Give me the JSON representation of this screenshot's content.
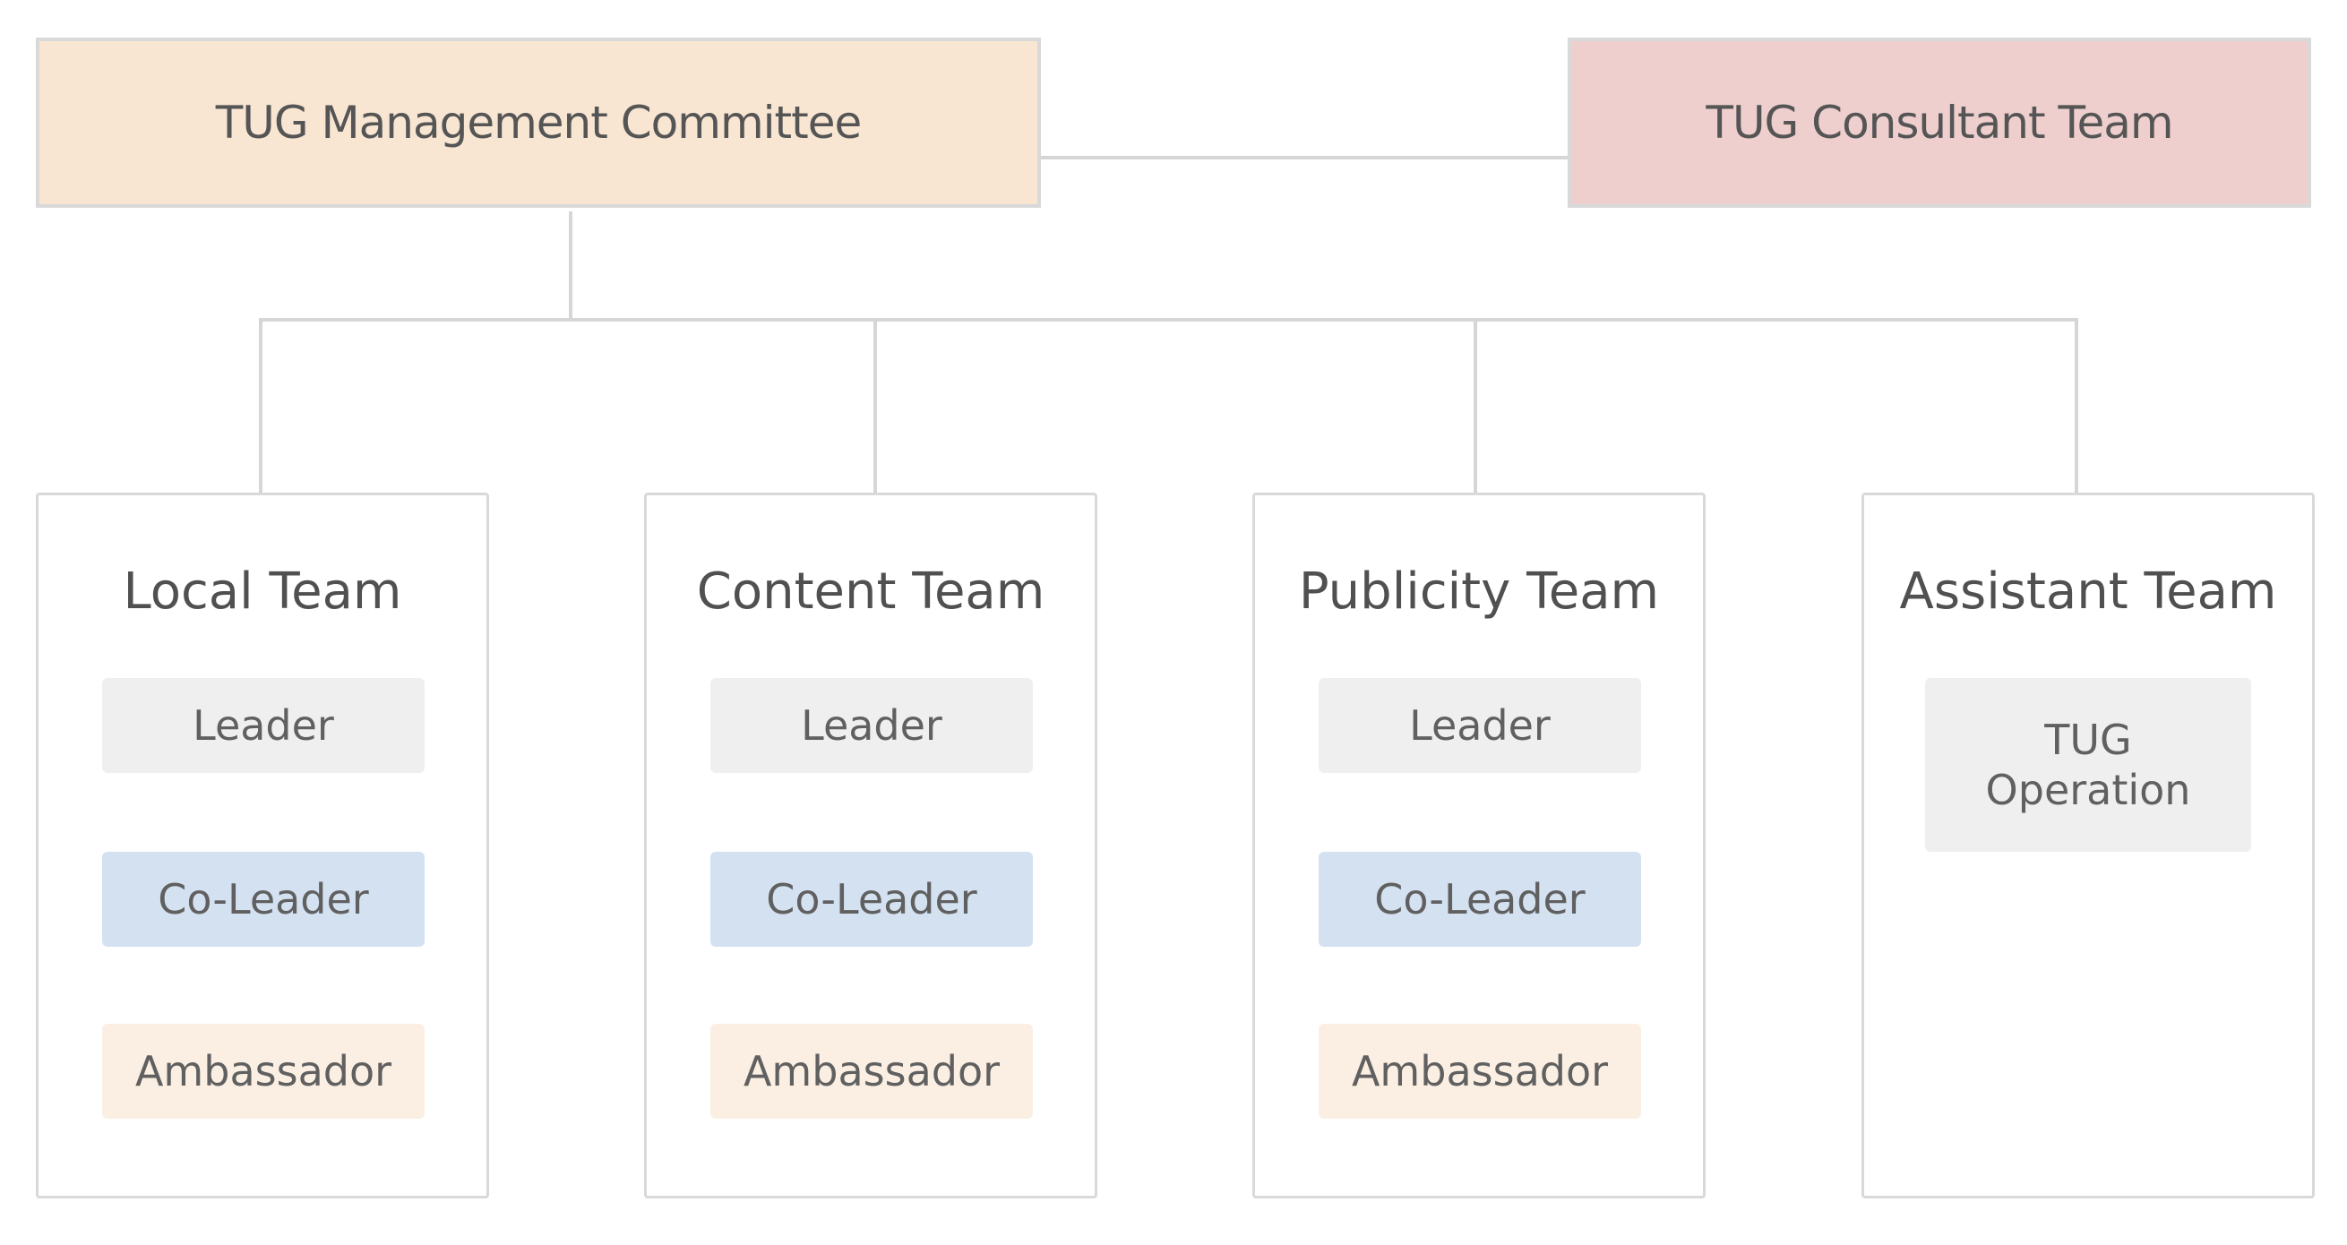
{
  "top": {
    "management": {
      "label": "TUG Management Committee",
      "color": "#f8e6d3"
    },
    "consultant": {
      "label": "TUG Consultant Team",
      "color": "#eecfcd"
    }
  },
  "teams": [
    {
      "title": "Local Team",
      "roles": [
        "Leader",
        "Co-Leader",
        "Ambassador"
      ]
    },
    {
      "title": "Content Team",
      "roles": [
        "Leader",
        "Co-Leader",
        "Ambassador"
      ]
    },
    {
      "title": "Publicity Team",
      "roles": [
        "Leader",
        "Co-Leader",
        "Ambassador"
      ]
    },
    {
      "title": "Assistant Team",
      "roles": [
        "TUG Operation"
      ]
    }
  ],
  "colors": {
    "leader": "#efefef",
    "co_leader": "#d4e1f1",
    "ambassador": "#fbefe3",
    "connector": "#d6d6d6"
  }
}
